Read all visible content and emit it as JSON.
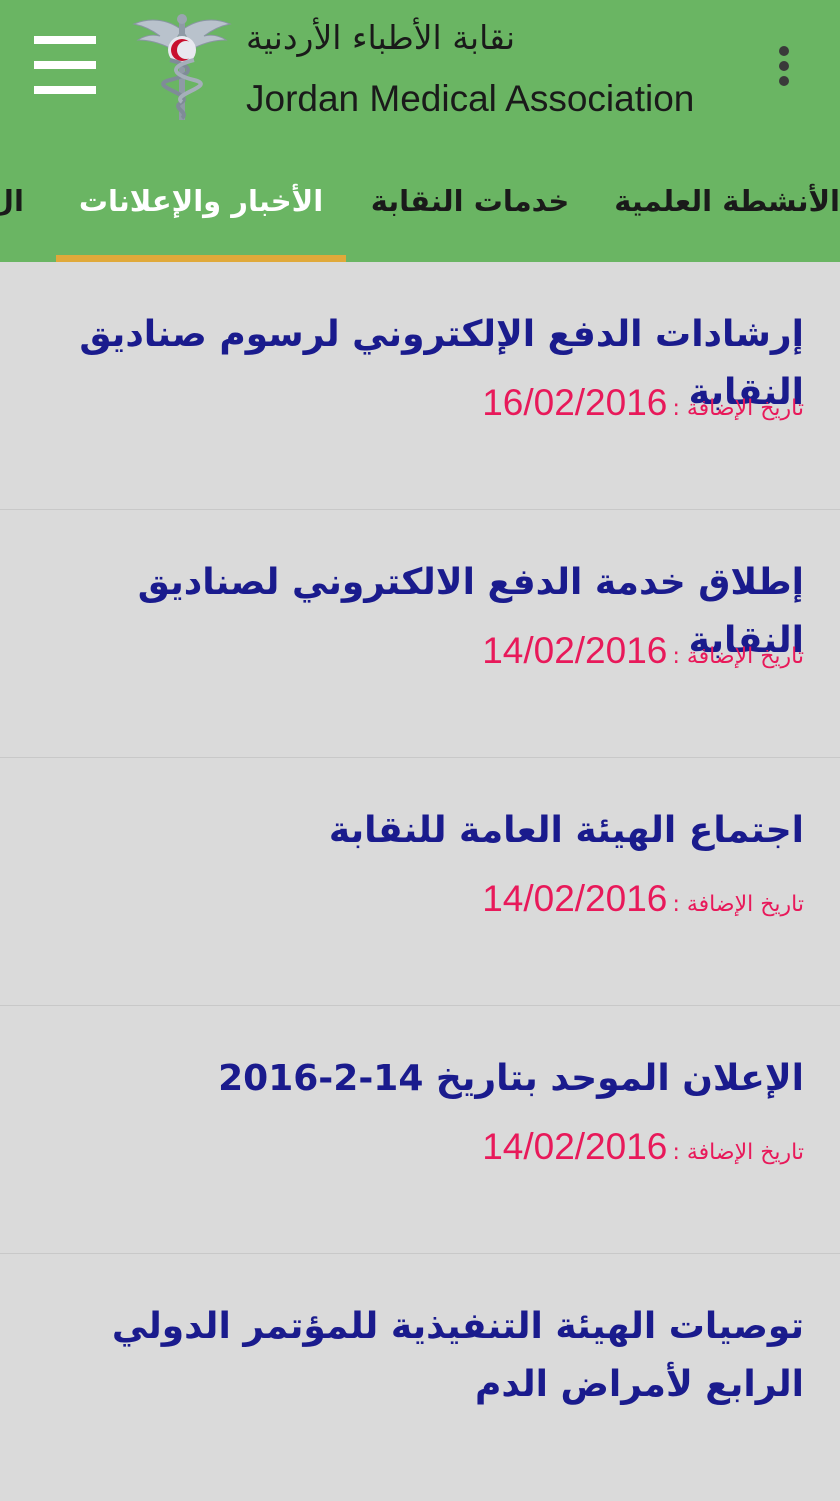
{
  "header": {
    "title_ar": "نقابة الأطباء الأردنية",
    "title_en": "Jordan Medical Association"
  },
  "tabs": [
    {
      "label": "الأنشطة العلمية"
    },
    {
      "label": "خدمات النقابة"
    },
    {
      "label": "الأخبار والإعلانات"
    },
    {
      "label": "ال"
    }
  ],
  "active_tab_index": 2,
  "date_label": "تاريخ الإضافة :",
  "news": [
    {
      "title": "إرشادات الدفع الإلكتروني لرسوم صناديق النقابة",
      "date": "16/02/2016"
    },
    {
      "title": "إطلاق خدمة الدفع الالكتروني لصناديق النقابة",
      "date": "14/02/2016"
    },
    {
      "title": "اجتماع الهيئة العامة للنقابة",
      "date": "14/02/2016"
    },
    {
      "title": "الإعلان الموحد بتاريخ 14-2-2016",
      "date": "14/02/2016"
    },
    {
      "title": "توصيات الهيئة التنفيذية للمؤتمر الدولي الرابع لأمراض الدم",
      "date": ""
    }
  ],
  "colors": {
    "appbar": "#6ab563",
    "indicator": "#e0a93a",
    "title_text": "#1a1b8d",
    "date_text": "#e8195a",
    "background": "#dadada"
  },
  "icons": [
    "menu-icon",
    "overflow-menu-icon",
    "caduceus-logo"
  ]
}
